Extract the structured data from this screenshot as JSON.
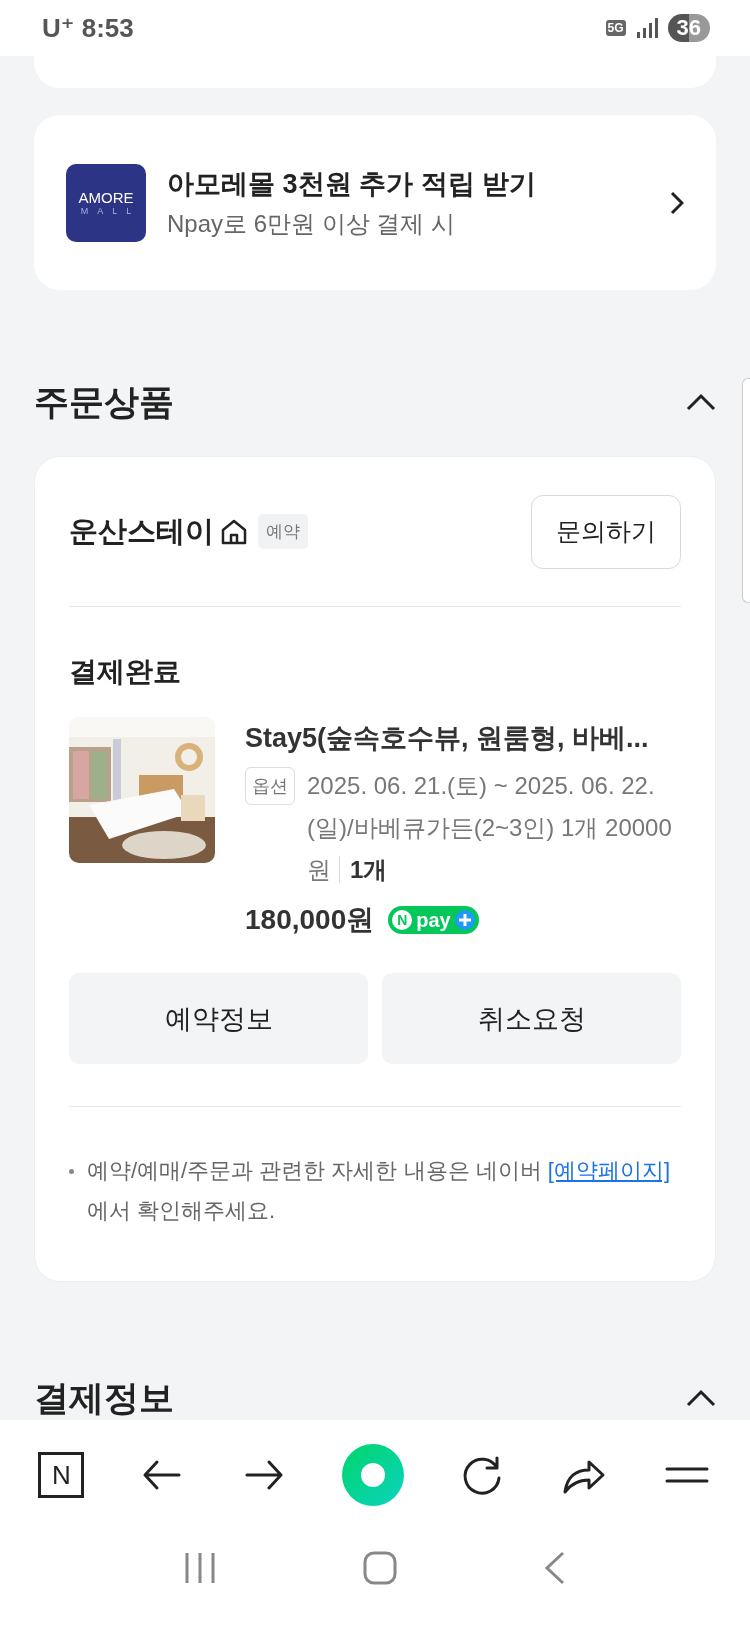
{
  "status_bar": {
    "carrier": "U⁺",
    "time": "8:53",
    "network": "5G",
    "battery": "36"
  },
  "promo": {
    "title": "아모레몰 3천원 추가 적립 받기",
    "subtitle": "Npay로 6만원 이상 결제 시",
    "logo_top": "AMORE",
    "logo_bottom": "MALL"
  },
  "order_section": {
    "title": "주문상품",
    "expanded": true,
    "store": {
      "name": "운산스테이",
      "badge": "예약",
      "inquiry_button": "문의하기"
    },
    "status": "결제완료",
    "product": {
      "title": "Stay5(숲속호수뷰, 원룸형, 바베...",
      "option_label": "옵션",
      "option_text": "2025. 06. 21.(토) ~ 2025. 06. 22.(일)/바베큐가든(2~3인) 1개 20000원",
      "quantity": "1개",
      "price": "180,000원",
      "npay_badge": {
        "n": "N",
        "label": "pay"
      }
    },
    "buttons": [
      "예약정보",
      "취소요청"
    ],
    "note": {
      "text": "예약/예매/주문과 관련한 자세한 내용은 네이버 ",
      "link": "[예약페이지]",
      "after": "에서 확인해주세요."
    }
  },
  "payment_section": {
    "title": "결제정보",
    "expanded": true
  },
  "toolbar": {
    "home_letter": "N"
  }
}
